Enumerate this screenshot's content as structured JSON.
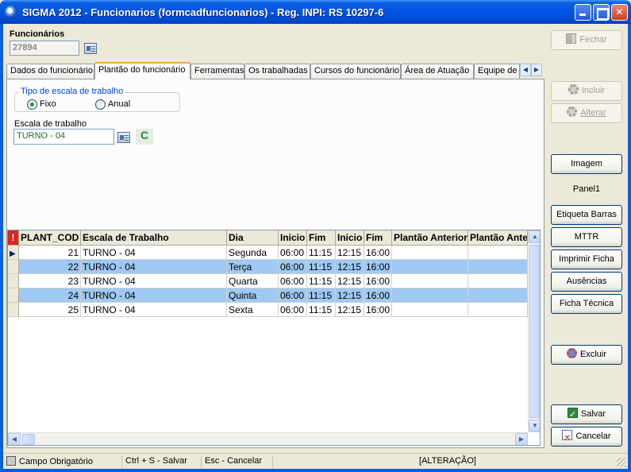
{
  "window": {
    "title": "SIGMA 2012 - Funcionarios  (formcadfuncionarios)  - Reg. INPI: RS 10297-6"
  },
  "header": {
    "label": "Funcionários",
    "id_value": "27894"
  },
  "tabs": [
    {
      "label": "Dados do funcionário"
    },
    {
      "label": "Plantão do funcionário"
    },
    {
      "label": "Ferramentas"
    },
    {
      "label": "Os trabalhadas"
    },
    {
      "label": "Cursos do funcionário"
    },
    {
      "label": "Área de Atuação"
    },
    {
      "label": "Equipe de"
    }
  ],
  "scale_type": {
    "group_title": "Tipo de escala de trabalho",
    "options": [
      {
        "label": "Fixo",
        "checked": true
      },
      {
        "label": "Anual",
        "checked": false
      }
    ]
  },
  "work_scale": {
    "label": "Escala de trabalho",
    "value": "TURNO - 04",
    "clear_glyph": "C"
  },
  "grid": {
    "required_marker": "!",
    "columns": [
      "PLANT_COD",
      "Escala de Trabalho",
      "Dia",
      "Inicio",
      "Fim",
      "Inicio",
      "Fim",
      "Plantão Anterior",
      "Plantão Ante"
    ],
    "rows": [
      {
        "code": "21",
        "scale": "TURNO - 04",
        "day": "Segunda",
        "start1": "06:00",
        "end1": "11:15",
        "start2": "12:15",
        "end2": "16:00",
        "selected": false,
        "current": true
      },
      {
        "code": "22",
        "scale": "TURNO - 04",
        "day": "Terça",
        "start1": "06:00",
        "end1": "11:15",
        "start2": "12:15",
        "end2": "16:00",
        "selected": true,
        "current": false
      },
      {
        "code": "23",
        "scale": "TURNO - 04",
        "day": "Quarta",
        "start1": "06:00",
        "end1": "11:15",
        "start2": "12:15",
        "end2": "16:00",
        "selected": false,
        "current": false
      },
      {
        "code": "24",
        "scale": "TURNO - 04",
        "day": "Quinta",
        "start1": "06:00",
        "end1": "11:15",
        "start2": "12:15",
        "end2": "16:00",
        "selected": true,
        "current": false
      },
      {
        "code": "25",
        "scale": "TURNO - 04",
        "day": "Sexta",
        "start1": "06:00",
        "end1": "11:15",
        "start2": "12:15",
        "end2": "16:00",
        "selected": false,
        "current": false
      }
    ]
  },
  "side": {
    "close": "Fechar",
    "include": "Incluir",
    "edit": "Alterar",
    "image": "Imagem",
    "panel": "Panel1",
    "barcode": "Etiqueta Barras",
    "mttr": "MTTR",
    "print": "Imprimir Ficha",
    "absences": "Ausências",
    "tech_sheet": "Ficha Técnica",
    "delete": "Excluir",
    "save": "Salvar",
    "cancel": "Cancelar"
  },
  "status": {
    "required": "Campo Obrigatório",
    "save_hint": "Ctrl + S - Salvar",
    "cancel_hint": "Esc - Cancelar",
    "mode": "[ALTERAÇÃO]"
  }
}
